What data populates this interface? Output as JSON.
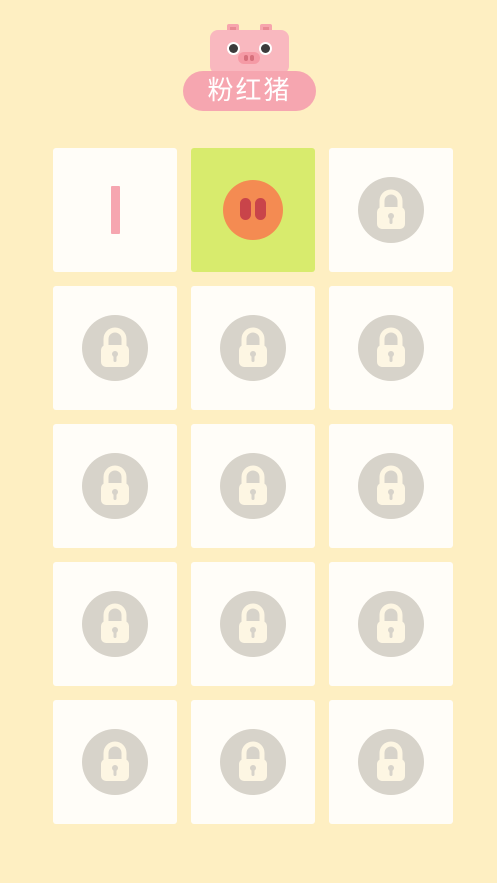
{
  "header": {
    "mascot_icon": "pig-face-icon",
    "title": "粉红猪"
  },
  "levels": [
    {
      "label": "I",
      "state": "completed"
    },
    {
      "label": "",
      "state": "current",
      "icon": "pig-snout-icon"
    },
    {
      "label": "",
      "state": "locked",
      "icon": "lock-icon"
    },
    {
      "label": "",
      "state": "locked",
      "icon": "lock-icon"
    },
    {
      "label": "",
      "state": "locked",
      "icon": "lock-icon"
    },
    {
      "label": "",
      "state": "locked",
      "icon": "lock-icon"
    },
    {
      "label": "",
      "state": "locked",
      "icon": "lock-icon"
    },
    {
      "label": "",
      "state": "locked",
      "icon": "lock-icon"
    },
    {
      "label": "",
      "state": "locked",
      "icon": "lock-icon"
    },
    {
      "label": "",
      "state": "locked",
      "icon": "lock-icon"
    },
    {
      "label": "",
      "state": "locked",
      "icon": "lock-icon"
    },
    {
      "label": "",
      "state": "locked",
      "icon": "lock-icon"
    },
    {
      "label": "",
      "state": "locked",
      "icon": "lock-icon"
    },
    {
      "label": "",
      "state": "locked",
      "icon": "lock-icon"
    },
    {
      "label": "",
      "state": "locked",
      "icon": "lock-icon"
    }
  ],
  "colors": {
    "background": "#feefc2",
    "tile": "#fffdf8",
    "current_tile": "#d8eb6d",
    "accent_pink": "#f6a6b0",
    "lock_circle": "#d7d3ca",
    "snout_orange": "#f48b52"
  }
}
